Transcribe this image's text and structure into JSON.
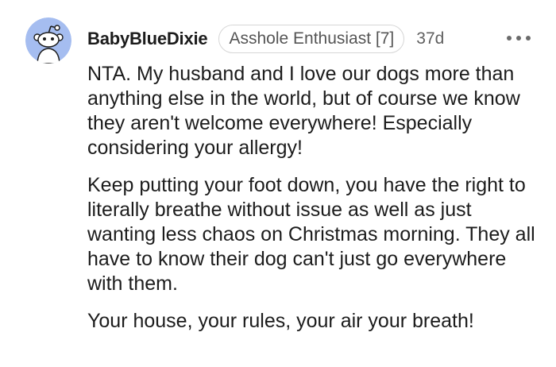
{
  "comment": {
    "username": "BabyBlueDixie",
    "flair": "Asshole Enthusiast [7]",
    "age": "37d",
    "more_icon": "more-options-icon",
    "avatar_icon": "snoo-avatar-icon",
    "paragraphs": [
      "NTA. My husband and I love our dogs more than anything else in the world, but of course we know they aren't welcome everywhere! Especially considering your allergy!",
      "Keep putting your foot down, you have the right to literally breathe without issue as well as just wanting less chaos on Christmas morning. They all have to know their dog can't just go everywhere with them.",
      "Your house, your rules, your air your breath!"
    ]
  },
  "colors": {
    "avatar_bg": "#a5bdf0",
    "text": "#1c1c1c",
    "muted": "#606060",
    "flair_border": "#d6d6d6"
  }
}
